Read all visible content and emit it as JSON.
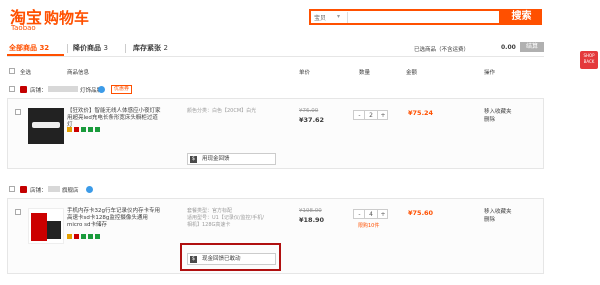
{
  "logo": {
    "cn": "淘宝",
    "en": "Taobao"
  },
  "cart_title": "购物车",
  "search": {
    "scope": "宝贝",
    "button": "搜索"
  },
  "tabs": [
    {
      "label": "全部商品",
      "count": "32"
    },
    {
      "label": "降价商品",
      "count": "3"
    },
    {
      "label": "库存紧张",
      "count": "2"
    }
  ],
  "summary": {
    "selected_label": "已选商品（不含运费）",
    "total": "0.00",
    "settle": "结算"
  },
  "columns": {
    "select_all": "全选",
    "item_info": "商品信息",
    "unit_price": "单价",
    "quantity": "数量",
    "amount": "金额",
    "actions": "操作"
  },
  "side_tag": "SHOP BACK",
  "shops": [
    {
      "label": "店铺：",
      "name": "灯饰品牌",
      "coupon": "优惠券",
      "item": {
        "title": "【狂欢价】智能无线人体感应小夜灯家用超亮led充电长条形宽床头橱柜过道灯",
        "attr1": "颜色分类：白色【20CM】白光",
        "old_price": "¥76.00",
        "price": "¥37.62",
        "quantity": "2",
        "amount": "¥75.24",
        "action1": "移入收藏夹",
        "action2": "删除",
        "cash": "用现金回馈"
      }
    },
    {
      "label": "店铺：",
      "name": "旗舰店",
      "item": {
        "title": "手机内存卡32g行车记录仪内存卡专用高速卡sd卡128g监控摄像头通用micro sd卡储存",
        "attr1": "套餐类型：官方标配",
        "attr2": "适用型号：U1【记录仪/监控/手机/",
        "attr3": "相机】128G高速卡",
        "old_price": "¥198.00",
        "price": "¥18.90",
        "quantity": "4",
        "limit": "限购10件",
        "amount": "¥75.60",
        "action1": "移入收藏夹",
        "action2": "删除",
        "cash": "现金回馈已敢动"
      }
    }
  ]
}
